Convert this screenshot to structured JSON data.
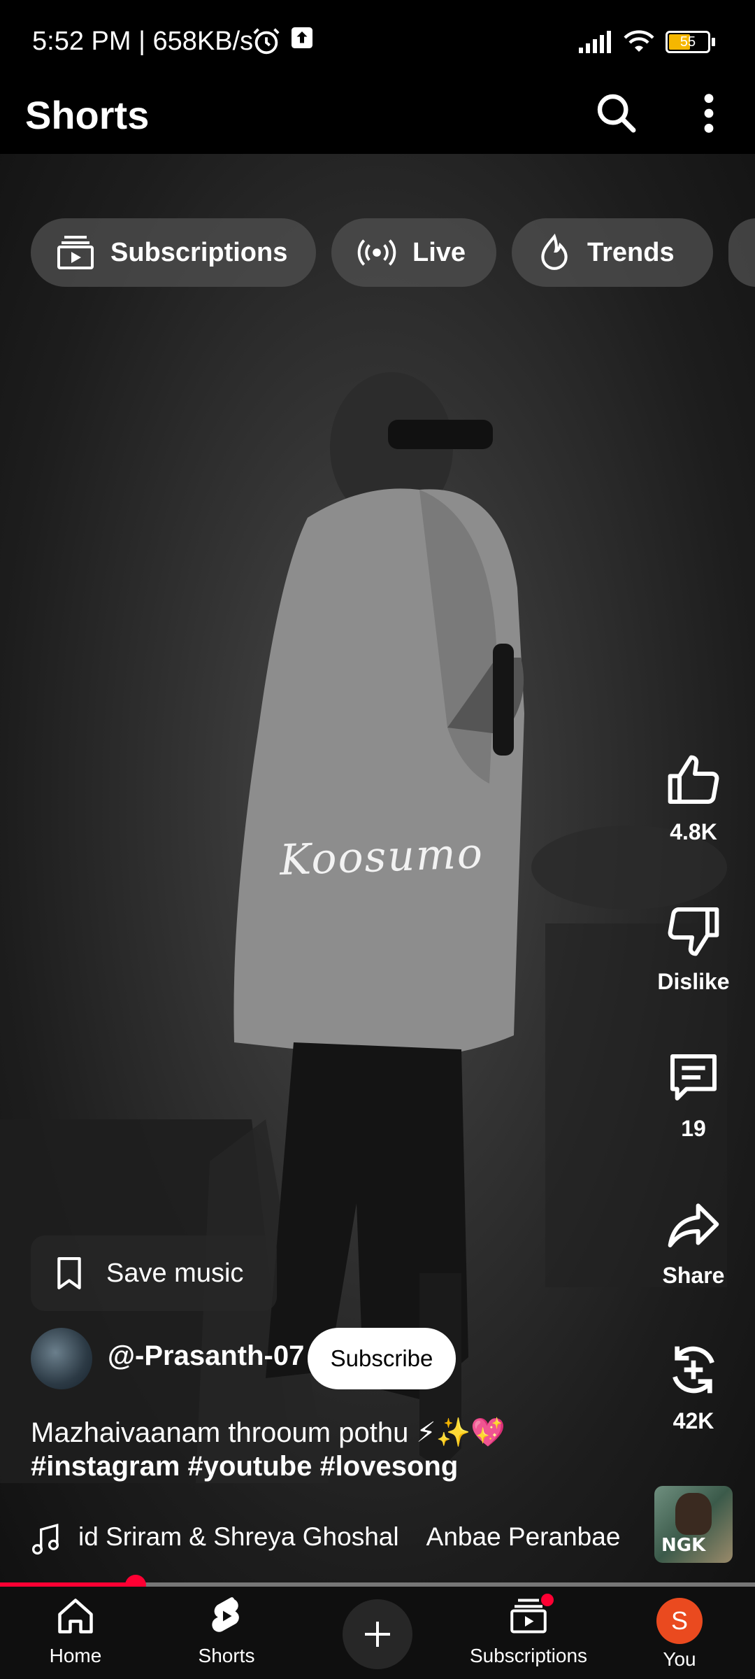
{
  "status_bar": {
    "time_speed": "5:52 PM | 658KB/s",
    "battery": "55"
  },
  "header": {
    "title": "Shorts",
    "search_icon": "search-icon",
    "more_icon": "more-vert-icon"
  },
  "chips": [
    {
      "label": "Subscriptions",
      "icon": "subscriptions-icon"
    },
    {
      "label": "Live",
      "icon": "live-icon"
    },
    {
      "label": "Trends",
      "icon": "trends-icon"
    }
  ],
  "video": {
    "watermark": "Koosumo"
  },
  "actions": {
    "like": "4.8K",
    "dislike": "Dislike",
    "comments": "19",
    "share": "Share",
    "remix": "42K"
  },
  "save_music": {
    "label": "Save music"
  },
  "channel": {
    "handle": "@-Prasanth-07",
    "subscribe_label": "Subscribe"
  },
  "caption": {
    "line1": "Mazhaivaanam throoum pothu ⚡✨💖",
    "line2": "#instagram #youtube #lovesong"
  },
  "music": {
    "track_text": "id Sriram & Shreya Ghoshal    Anbae Peranbae",
    "thumbnail_text": "NGK"
  },
  "progress": {
    "fraction": 0.18
  },
  "bottom_nav": [
    {
      "label": "Home",
      "icon": "home-icon"
    },
    {
      "label": "Shorts",
      "icon": "shorts-icon"
    },
    {
      "label": "",
      "icon": "create-icon"
    },
    {
      "label": "Subscriptions",
      "icon": "subscriptions-icon"
    },
    {
      "label": "You",
      "icon": "avatar-icon",
      "avatar_letter": "S"
    }
  ],
  "colors": {
    "accent": "#ff0033",
    "avatar": "#ea4a1f"
  }
}
